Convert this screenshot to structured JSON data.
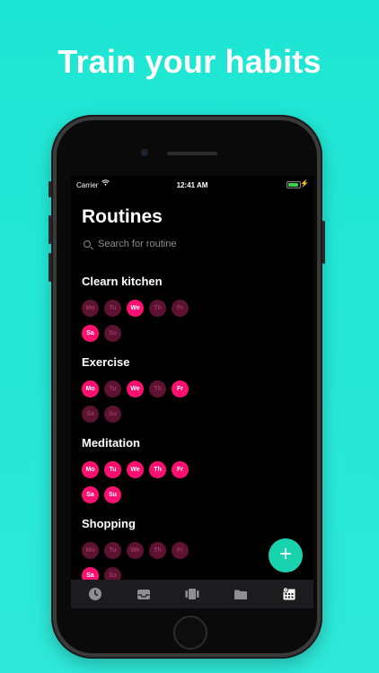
{
  "headline": "Train your habits",
  "status_bar": {
    "carrier": "Carrier",
    "time": "12:41 AM"
  },
  "screen": {
    "title": "Routines",
    "search": {
      "placeholder": "Search for routine"
    }
  },
  "days": [
    "Mo",
    "Tu",
    "We",
    "Th",
    "Fr",
    "Sa",
    "Su"
  ],
  "routines": [
    {
      "name": "Clearn kitchen",
      "active": [
        false,
        false,
        true,
        false,
        false,
        true,
        false
      ]
    },
    {
      "name": "Exercise",
      "active": [
        true,
        false,
        true,
        false,
        true,
        false,
        false
      ]
    },
    {
      "name": "Meditation",
      "active": [
        true,
        true,
        true,
        true,
        true,
        true,
        true
      ]
    },
    {
      "name": "Shopping",
      "active": [
        false,
        false,
        false,
        false,
        false,
        true,
        false
      ]
    }
  ],
  "fab_label": "+",
  "tabs": [
    {
      "icon": "clock-icon"
    },
    {
      "icon": "inbox-icon"
    },
    {
      "icon": "cards-icon"
    },
    {
      "icon": "folder-icon"
    },
    {
      "icon": "calendar-icon",
      "selected": true
    }
  ],
  "colors": {
    "background": "#1ee6d4",
    "day_on": "#ff0f6f",
    "day_off": "#5c1230",
    "fab": "#19d2ae"
  }
}
